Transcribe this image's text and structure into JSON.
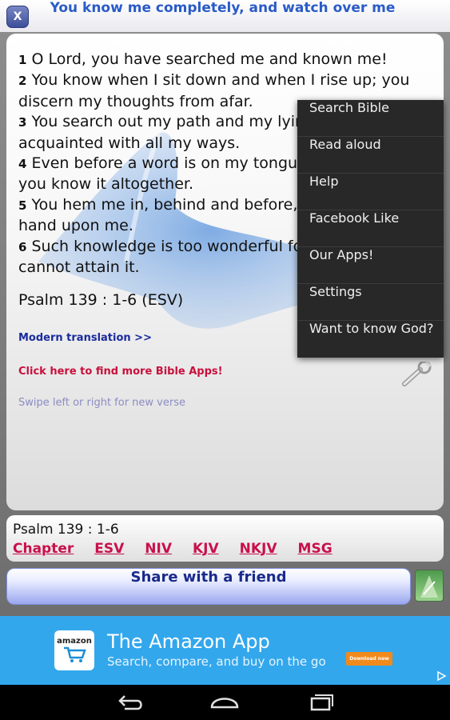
{
  "header": {
    "close_label": "X",
    "title": "You know me completely, and watch over me"
  },
  "verses": [
    {
      "num": "1",
      "text": "O Lord, you have searched me and known me!"
    },
    {
      "num": "2",
      "text": "You know when I sit down and when I rise up; you discern my thoughts from afar."
    },
    {
      "num": "3",
      "text": "You search out my path and my lying down and are acquainted with all my ways."
    },
    {
      "num": "4",
      "text": "Even before a word is on my tongue, behold, O Lord, you know it altogether."
    },
    {
      "num": "5",
      "text": "You hem me in, behind and before, and lay your hand upon me."
    },
    {
      "num": "6",
      "text": "Such knowledge is too wonderful for me; it is high; I cannot attain it."
    }
  ],
  "reference": "Psalm 139 : 1-6  (ESV)",
  "links": {
    "modern": "Modern translation >>",
    "more_apps": "Click here to find more Bible Apps!",
    "swipe_hint": "Swipe left or right for new verse"
  },
  "ref_panel": {
    "label": "Psalm 139 : 1-6",
    "translations": [
      "Chapter",
      "ESV",
      "NIV",
      "KJV",
      "NKJV",
      "MSG"
    ]
  },
  "share_label": "Share with a friend",
  "menu": [
    "Search Bible",
    "Read aloud",
    "Help",
    "Facebook Like",
    "Our Apps!",
    "Settings",
    "Want to know God?"
  ],
  "ad": {
    "logo_text": "amazon",
    "title": "The Amazon App",
    "subtitle": "Search, compare, and buy on the go",
    "button": "Download now"
  },
  "colors": {
    "title": "#2a5bc7",
    "link_red": "#c8104c",
    "ad_bg": "#33a7ec",
    "menu_bg": "#282828"
  },
  "icons": [
    "close-icon",
    "wrench-icon",
    "share-image-icon",
    "ad-choices-icon",
    "back-icon",
    "home-icon",
    "recents-icon"
  ]
}
